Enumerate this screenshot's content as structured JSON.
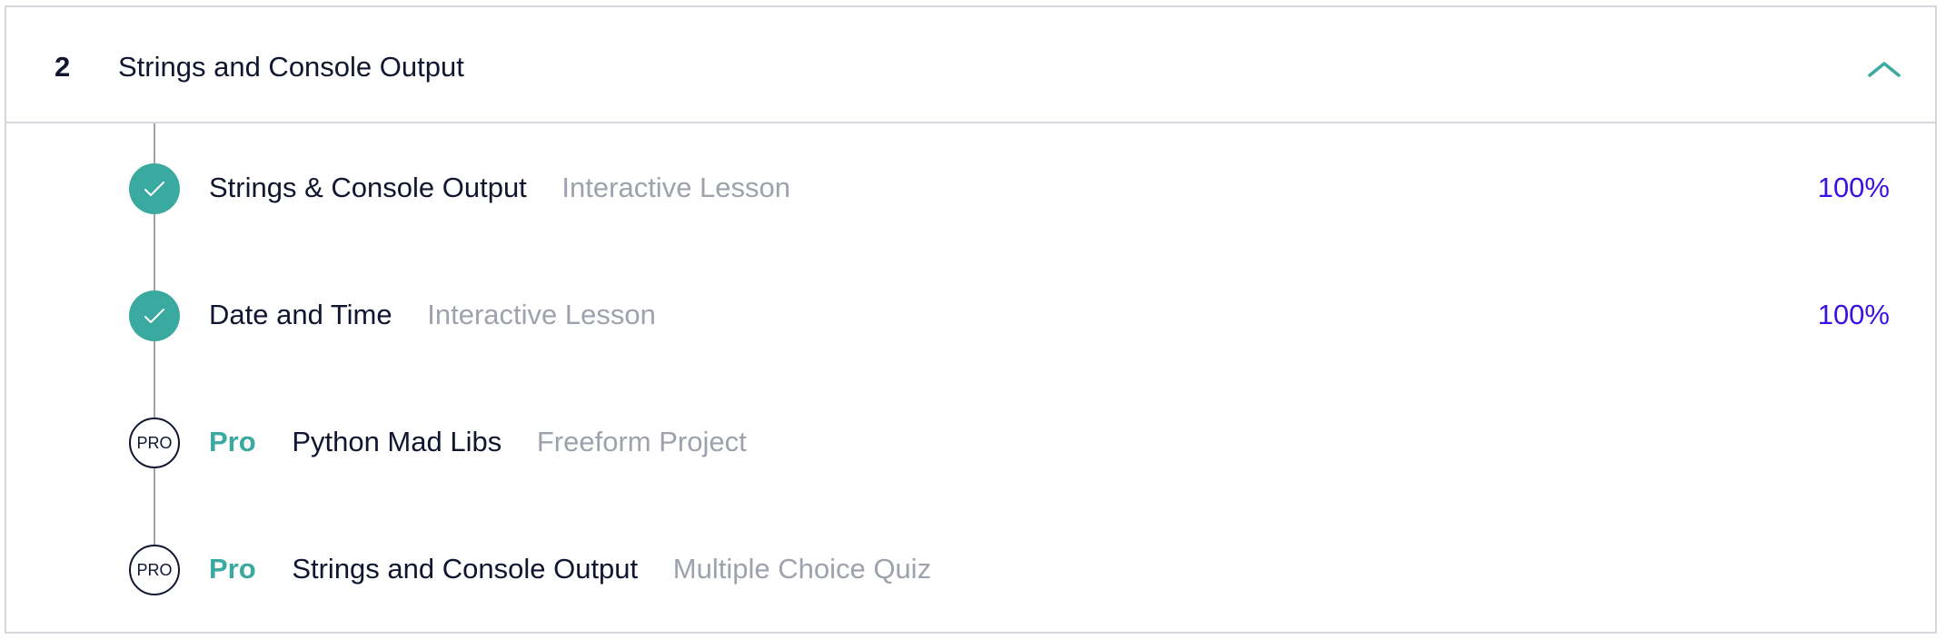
{
  "module": {
    "number": "2",
    "title": "Strings and Console Output",
    "toggle_icon": "chevron-up-icon"
  },
  "colors": {
    "accent_teal": "#3aa99f",
    "progress_purple": "#3a10e5",
    "text_dark": "#10162f",
    "text_muted": "#9ea2ad",
    "border": "#d5d7dc"
  },
  "items": [
    {
      "title": "Strings & Console Output",
      "type": "Interactive Lesson",
      "progress": "100%",
      "status_icon": "checkmark-icon"
    },
    {
      "title": "Date and Time",
      "type": "Interactive Lesson",
      "progress": "100%",
      "status_icon": "checkmark-icon"
    },
    {
      "pro_label": "Pro",
      "badge": "PRO",
      "title": "Python Mad Libs",
      "type": "Freeform Project",
      "status_icon": "pro-badge-icon"
    },
    {
      "pro_label": "Pro",
      "badge": "PRO",
      "title": "Strings and Console Output",
      "type": "Multiple Choice Quiz",
      "status_icon": "pro-badge-icon"
    }
  ]
}
